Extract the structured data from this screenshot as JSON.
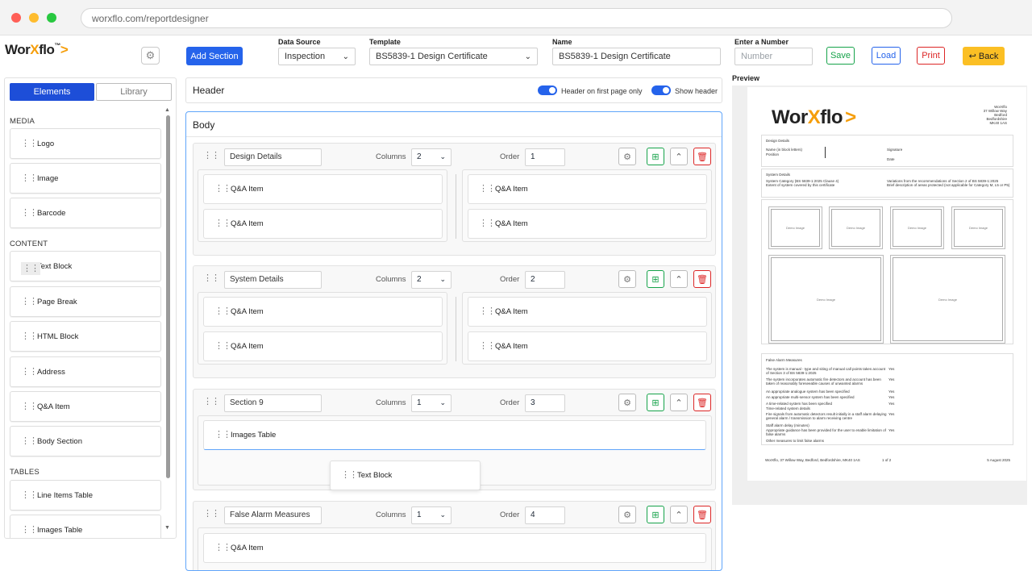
{
  "browser": {
    "url": "worxflo.com/reportdesigner"
  },
  "app": {
    "logo_prefix": "Wor",
    "logo_x": "X",
    "logo_suffix": "flo",
    "logo_tm": "™",
    "logo_arrow": ">"
  },
  "toolbar": {
    "add_section": "Add Section",
    "data_source_label": "Data Source",
    "data_source_value": "Inspection",
    "template_label": "Template",
    "template_value": "BS5839-1 Design Certificate",
    "name_label": "Name",
    "name_value": "BS5839-1 Design Certificate",
    "number_label": "Enter a Number",
    "number_placeholder": "Number",
    "save": "Save",
    "load": "Load",
    "print": "Print",
    "back": "Back"
  },
  "left_panel": {
    "tabs": [
      "Elements",
      "Library"
    ],
    "groups": [
      {
        "title": "MEDIA",
        "items": [
          "Logo",
          "Image",
          "Barcode"
        ]
      },
      {
        "title": "CONTENT",
        "items": [
          "Text Block",
          "Page Break",
          "HTML Block",
          "Address",
          "Q&A Item",
          "Body Section"
        ]
      },
      {
        "title": "TABLES",
        "items": [
          "Line Items Table",
          "Images Table"
        ]
      }
    ]
  },
  "header_panel": {
    "title": "Header",
    "toggle1": "Header on first page only",
    "toggle2": "Show header"
  },
  "body_panel": {
    "title": "Body",
    "columns_label": "Columns",
    "order_label": "Order",
    "sections": [
      {
        "name": "Design Details",
        "columns": "2",
        "order": "1",
        "col1": [
          "Q&A Item",
          "Q&A Item"
        ],
        "col2": [
          "Q&A Item",
          "Q&A Item"
        ]
      },
      {
        "name": "System Details",
        "columns": "2",
        "order": "2",
        "col1": [
          "Q&A Item",
          "Q&A Item"
        ],
        "col2": [
          "Q&A Item",
          "Q&A Item"
        ]
      },
      {
        "name": "Section 9",
        "columns": "1",
        "order": "3",
        "col1": [
          "Images Table"
        ]
      },
      {
        "name": "False Alarm Measures",
        "columns": "1",
        "order": "4",
        "col1": [
          "Q&A Item"
        ]
      }
    ],
    "drag_item": "Text Block"
  },
  "preview": {
    "label": "Preview",
    "company_lines": [
      "WorXflo",
      "37 Willow Way",
      "Bedford",
      "Bedfordshire",
      "MK40 1AS"
    ],
    "design_details": {
      "title": "Design Details",
      "name_label": "Name (in block letters)",
      "position_label": "Position",
      "signature_label": "Signature",
      "date_label": "Date"
    },
    "system_details": {
      "title": "System Details",
      "left": [
        "System Category (BS 5839-1:2025 Clause 4)",
        "Extent of system covered by this certificate"
      ],
      "right": [
        "Variations from the recommendations of Section 2 of BS 5839-1:2025",
        "Brief description of areas protected (not applicable for Category M, L5 or P5)"
      ]
    },
    "demo_image": "Demo Image",
    "false_alarm": {
      "title": "False Alarm Measures",
      "rows": [
        {
          "q": "The system is manual - type and siting of manual call points takes account of Section 3 of BS 5839-1:2025",
          "a": "Yes"
        },
        {
          "q": "The system incorporates automatic fire detectors and account has been taken of reasonably foreseeable causes of unwanted alarms",
          "a": "Yes"
        },
        {
          "q": "An appropriate analogue system has been specified",
          "a": "Yes"
        },
        {
          "q": "An appropriate multi-sensor system has been specified",
          "a": "Yes"
        },
        {
          "q": "A time-related system has been specified",
          "a": "Yes"
        },
        {
          "q": "Time-related system details",
          "a": ""
        },
        {
          "q": "Fire signals from automatic detectors result initially in a staff alarm delaying general alarm / transmission to alarm receiving centre",
          "a": "Yes"
        },
        {
          "q": "Staff alarm delay (minutes)",
          "a": ""
        },
        {
          "q": "Appropriate guidance has been provided for the user to enable limitation of false alarms",
          "a": "Yes"
        },
        {
          "q": "Other measures to limit false alarms",
          "a": ""
        }
      ]
    },
    "footer": {
      "left": "WorXflo, 37 Willow Way, Bedford, Bedfordshire, MK40 1AS",
      "center": "1 of 2",
      "right": "5 August 2025"
    }
  }
}
